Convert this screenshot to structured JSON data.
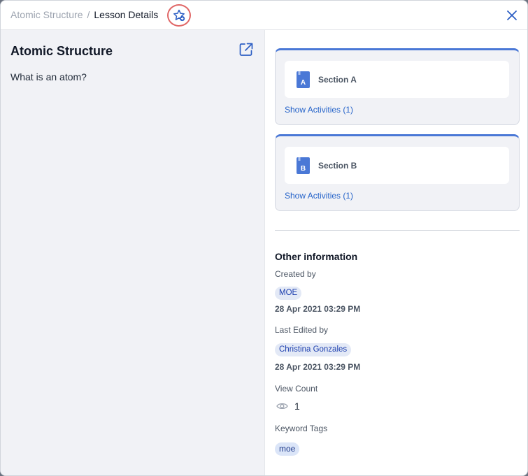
{
  "header": {
    "breadcrumb_parent": "Atomic Structure",
    "breadcrumb_separator": "/",
    "breadcrumb_current": "Lesson Details"
  },
  "lesson": {
    "title": "Atomic Structure",
    "description": "What is an atom?"
  },
  "sections": [
    {
      "badge": "A",
      "name": "Section A",
      "activities_label": "Show Activities (1)"
    },
    {
      "badge": "B",
      "name": "Section B",
      "activities_label": "Show Activities (1)"
    }
  ],
  "other_info": {
    "title": "Other information",
    "created_by_label": "Created by",
    "created_by": "MOE",
    "created_date": "28 Apr 2021 03:29 PM",
    "last_edited_label": "Last Edited by",
    "last_edited_by": "Christina Gonzales",
    "last_edited_date": "28 Apr 2021 03:29 PM",
    "view_count_label": "View Count",
    "view_count": "1",
    "keyword_tags_label": "Keyword Tags",
    "keyword_tags": [
      "moe"
    ]
  },
  "icons": {
    "star": "star-add-icon",
    "close": "close-icon",
    "external": "external-link-icon",
    "book": "book-icon",
    "eye": "eye-icon"
  },
  "colors": {
    "accent": "#4a78d6",
    "link": "#2563c9",
    "highlight_ring": "#e06767"
  }
}
